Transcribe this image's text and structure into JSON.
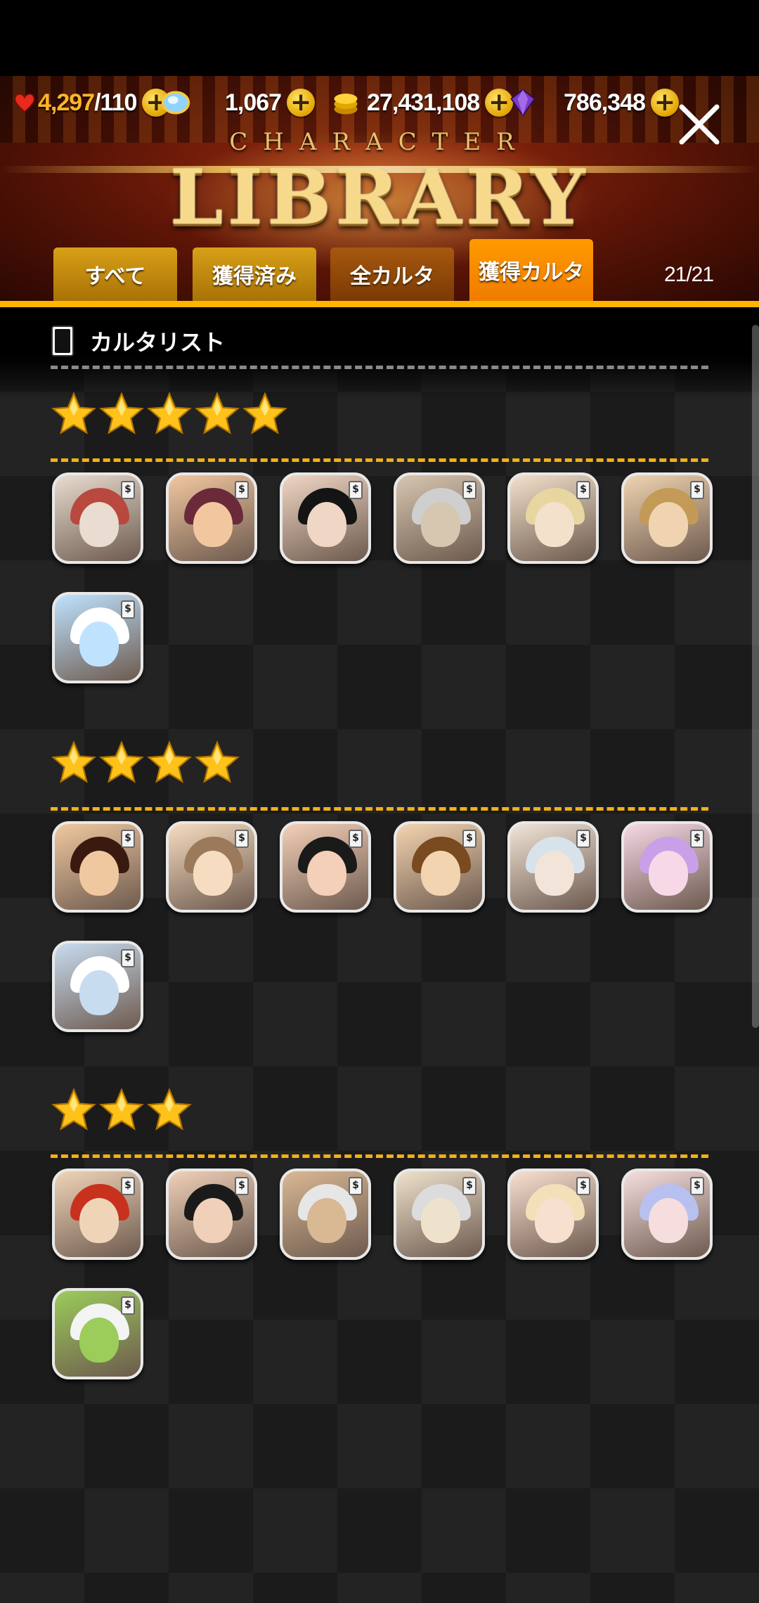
{
  "resources": {
    "stamina": "4,297",
    "stamina_max": "/110",
    "gems": "1,067",
    "coins": "27,431,108",
    "crystals": "786,348"
  },
  "header": {
    "subtitle": "CHARACTER",
    "title": "LIBRARY"
  },
  "tabs": [
    {
      "label": "すべて",
      "state": "inactive"
    },
    {
      "label": "獲得済み",
      "state": "inactive"
    },
    {
      "label": "全カルタ",
      "state": "inactive"
    },
    {
      "label": "獲得カルタ",
      "state": "active"
    }
  ],
  "count": "21/21",
  "list": {
    "title": "カルタリスト",
    "card_badge": "$"
  },
  "sections": [
    {
      "stars": 5,
      "card_count": 7
    },
    {
      "stars": 4,
      "card_count": 7
    },
    {
      "stars": 3,
      "card_count": 7
    }
  ],
  "colors": {
    "accent": "#ffb500",
    "active_tab": "#f58200",
    "star": "#ffc21a"
  }
}
